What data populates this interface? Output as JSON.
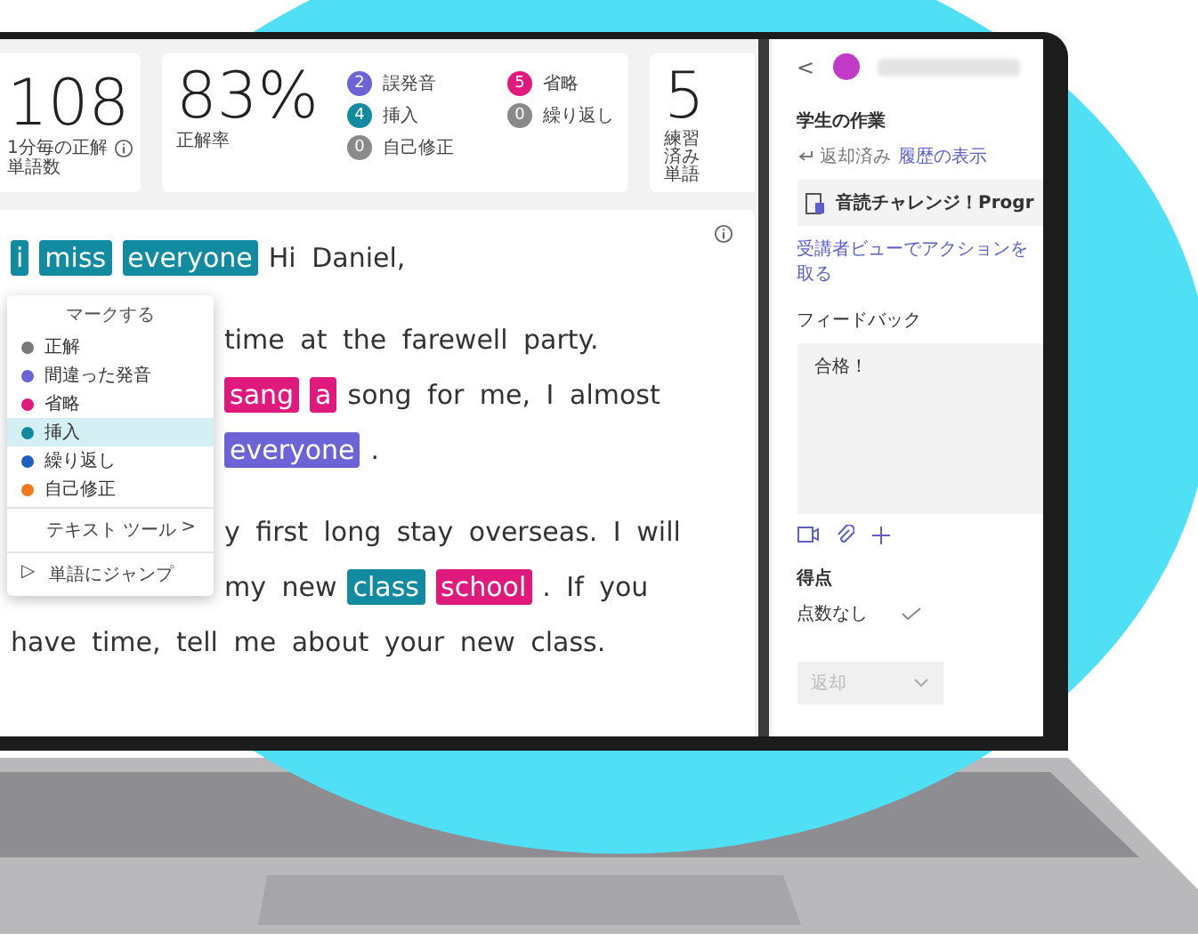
{
  "stats": {
    "wcpm": {
      "value": "108",
      "label": "1分毎の正解単語数"
    },
    "accuracy": {
      "value": "83%",
      "label": "正解率",
      "legend": [
        {
          "count": "2",
          "label": "誤発音",
          "color": "#6b63d6"
        },
        {
          "count": "4",
          "label": "挿入",
          "color": "#128ba0"
        },
        {
          "count": "0",
          "label": "自己修正",
          "color": "#8a8a8a"
        },
        {
          "count": "5",
          "label": "省略",
          "color": "#e0197d"
        },
        {
          "count": "0",
          "label": "繰り返し",
          "color": "#8a8a8a"
        }
      ]
    },
    "practiced": {
      "value": "5",
      "label": "練習済み単語"
    }
  },
  "passage": {
    "paragraphs": [
      [
        {
          "behind_menu": false,
          "segments": [
            {
              "text": "i",
              "kind": "insertion"
            },
            {
              "text": "miss",
              "kind": "insertion"
            },
            {
              "text": "everyone",
              "kind": "insertion"
            },
            {
              "text": "Hi Daniel,",
              "kind": "plain"
            }
          ]
        }
      ],
      [
        {
          "behind_menu": true,
          "segments": [
            {
              "text": "time at the farewell party.",
              "kind": "plain"
            }
          ]
        },
        {
          "behind_menu": true,
          "segments": [
            {
              "text": "sang",
              "kind": "omission"
            },
            {
              "text": "a",
              "kind": "omission"
            },
            {
              "text": "song for me, I almost",
              "kind": "plain"
            }
          ]
        },
        {
          "behind_menu": true,
          "segments": [
            {
              "text": "everyone",
              "kind": "mispronunciation"
            },
            {
              "text": ".",
              "kind": "plain"
            }
          ]
        }
      ],
      [
        {
          "behind_menu": true,
          "segments": [
            {
              "text": "y first long stay overseas. I will",
              "kind": "plain"
            }
          ]
        },
        {
          "behind_menu": true,
          "segments": [
            {
              "text": "my new",
              "kind": "plain"
            },
            {
              "text": "class",
              "kind": "insertion"
            },
            {
              "text": "school",
              "kind": "omission"
            },
            {
              "text": ". If you",
              "kind": "plain"
            }
          ]
        },
        {
          "behind_menu": false,
          "segments": [
            {
              "text": "have time, tell me about your new class.",
              "kind": "plain"
            }
          ]
        }
      ]
    ]
  },
  "menu": {
    "title": "マークする",
    "items": [
      {
        "label": "正解",
        "color": "#7a7a7a",
        "selected": false
      },
      {
        "label": "間違った発音",
        "color": "#6b63d6",
        "selected": false
      },
      {
        "label": "省略",
        "color": "#e0197d",
        "selected": false
      },
      {
        "label": "挿入",
        "color": "#128ba0",
        "selected": true
      },
      {
        "label": "繰り返し",
        "color": "#1f5fc0",
        "selected": false
      },
      {
        "label": "自己修正",
        "color": "#f07a1a",
        "selected": false
      }
    ],
    "submenu": {
      "label": "テキスト ツール",
      "arrow": ">"
    },
    "jump": {
      "arrow": "▷",
      "label": "単語にジャンプ"
    }
  },
  "side": {
    "back": "<",
    "section": "学生の作業",
    "status": "返却済み",
    "history_link": "履歴の表示",
    "attachment": "音読チャレンジ！Progr",
    "action_link": "受講者ビューでアクションを取る",
    "feedback_label": "フィードバック",
    "feedback": "合格！",
    "score_label": "得点",
    "score": "点数なし",
    "dropdown": {
      "label": "返却",
      "disabled": true
    }
  }
}
